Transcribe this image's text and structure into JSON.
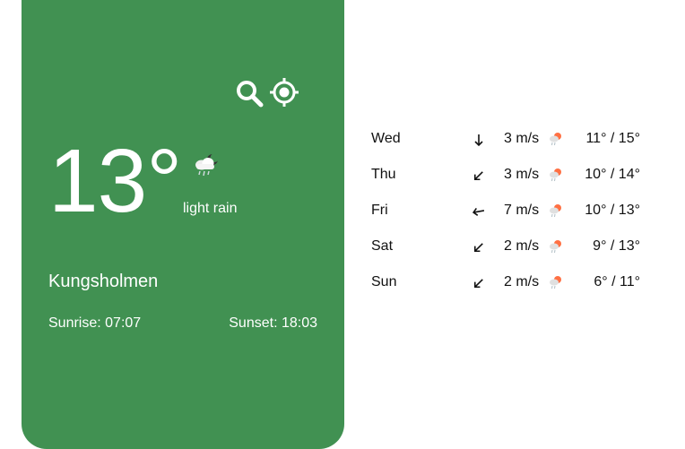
{
  "current": {
    "temperature": "13°",
    "condition": "light rain",
    "condition_icon": "cloud-rain-night-icon",
    "city": "Kungsholmen",
    "sunrise": "Sunrise: 07:07",
    "sunset": "Sunset: 18:03"
  },
  "toolbar": {
    "search_icon": "search-icon",
    "locate_icon": "crosshair-locate-icon"
  },
  "colors": {
    "card_background": "#419152",
    "text_on_card": "#ffffff",
    "forecast_text": "#111111"
  },
  "forecast": [
    {
      "day": "Wed",
      "wind_direction_icon": "arrow-down-icon",
      "wind": "3 m/s",
      "weather_icon": "rain-showers-icon",
      "range": "11° / 15°"
    },
    {
      "day": "Thu",
      "wind_direction_icon": "arrow-down-left-icon",
      "wind": "3 m/s",
      "weather_icon": "rain-showers-icon",
      "range": "10° / 14°"
    },
    {
      "day": "Fri",
      "wind_direction_icon": "arrow-left-icon",
      "wind": "7 m/s",
      "weather_icon": "rain-showers-icon",
      "range": "10° / 13°"
    },
    {
      "day": "Sat",
      "wind_direction_icon": "arrow-down-left-icon",
      "wind": "2 m/s",
      "weather_icon": "rain-showers-icon",
      "range": "9° / 13°"
    },
    {
      "day": "Sun",
      "wind_direction_icon": "arrow-down-left-icon",
      "wind": "2 m/s",
      "weather_icon": "rain-showers-icon",
      "range": "6° / 11°"
    }
  ]
}
